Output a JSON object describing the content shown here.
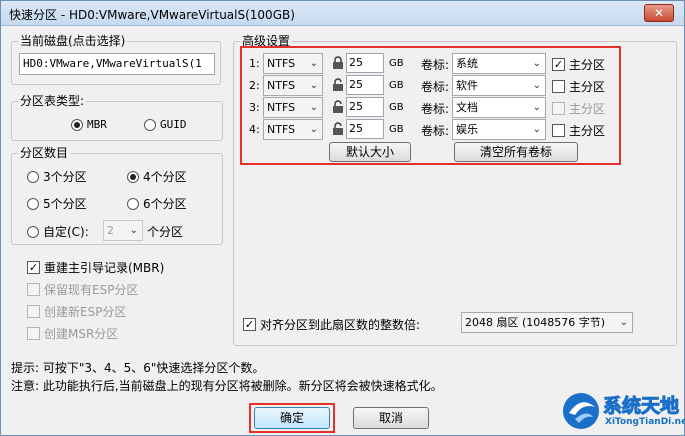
{
  "window": {
    "title": "快速分区 - HD0:VMware,VMwareVirtualS(100GB)",
    "close": "✕"
  },
  "disk": {
    "label": "当前磁盘(点击选择)",
    "value": "HD0:VMware,VMwareVirtualS(1"
  },
  "partition_table": {
    "label": "分区表类型:",
    "options": [
      "MBR",
      "GUID"
    ],
    "selected": "MBR"
  },
  "partition_count": {
    "label": "分区数目",
    "options": [
      "3个分区",
      "4个分区",
      "5个分区",
      "6个分区"
    ],
    "selected": "4个分区",
    "custom_label": "自定(C):",
    "custom_value": "2",
    "custom_suffix": "个分区"
  },
  "options": {
    "rebuild_mbr": "重建主引导记录(MBR)",
    "keep_esp": "保留现有ESP分区",
    "create_esp": "创建新ESP分区",
    "create_msr": "创建MSR分区"
  },
  "advanced": {
    "label": "高级设置",
    "volume_label_text": "卷标:",
    "primary_text": "主分区",
    "unit": "GB",
    "rows": [
      {
        "index": "1:",
        "fs": "NTFS",
        "size": "25",
        "volume": "系统",
        "primary": true,
        "primary_disabled": false
      },
      {
        "index": "2:",
        "fs": "NTFS",
        "size": "25",
        "volume": "软件",
        "primary": false,
        "primary_disabled": false
      },
      {
        "index": "3:",
        "fs": "NTFS",
        "size": "25",
        "volume": "文档",
        "primary": false,
        "primary_disabled": true
      },
      {
        "index": "4:",
        "fs": "NTFS",
        "size": "25",
        "volume": "娱乐",
        "primary": false,
        "primary_disabled": false
      }
    ],
    "default_size_btn": "默认大小",
    "clear_labels_btn": "清空所有卷标"
  },
  "align": {
    "label": "对齐分区到此扇区数的整数倍:",
    "value": "2048 扇区 (1048576 字节)"
  },
  "hints": {
    "hint": "提示: 可按下\"3、4、5、6\"快速选择分区个数。",
    "note": "注意: 此功能执行后,当前磁盘上的现有分区将被删除。新分区将会被快速格式化。"
  },
  "buttons": {
    "ok": "确定",
    "cancel": "取消"
  },
  "watermark": {
    "text": "系统天地",
    "sub": "XiTongTianDi.net"
  },
  "colors": {
    "highlight": "#e8302a",
    "title_bg": "#c6d9ef",
    "logo_blue": "#1a6fc9"
  }
}
